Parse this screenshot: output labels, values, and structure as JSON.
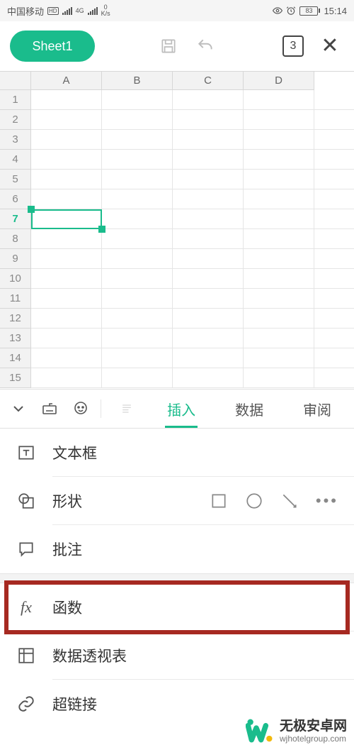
{
  "status": {
    "carrier": "中国移动",
    "hd": "HD",
    "net_type": "4G",
    "speed_val": "0",
    "speed_unit": "K/s",
    "battery": "83",
    "time": "15:14"
  },
  "toolbar": {
    "sheet_label": "Sheet1",
    "window_count": "3"
  },
  "grid": {
    "columns": [
      "A",
      "B",
      "C",
      "D"
    ],
    "rows": [
      "1",
      "2",
      "3",
      "4",
      "5",
      "6",
      "7",
      "8",
      "9",
      "10",
      "11",
      "12",
      "13",
      "14",
      "15"
    ],
    "selected_row_index": 6
  },
  "tabs": {
    "faded": "⋯",
    "insert": "插入",
    "data": "数据",
    "review": "审阅"
  },
  "panel": {
    "textbox": "文本框",
    "shape": "形状",
    "comment": "批注",
    "function": "函数",
    "pivot": "数据透视表",
    "hyperlink": "超链接"
  },
  "watermark": {
    "cn": "无极安卓网",
    "en": "wjhotelgroup.com"
  },
  "colors": {
    "accent": "#1abc8c",
    "highlight": "#a62921"
  }
}
